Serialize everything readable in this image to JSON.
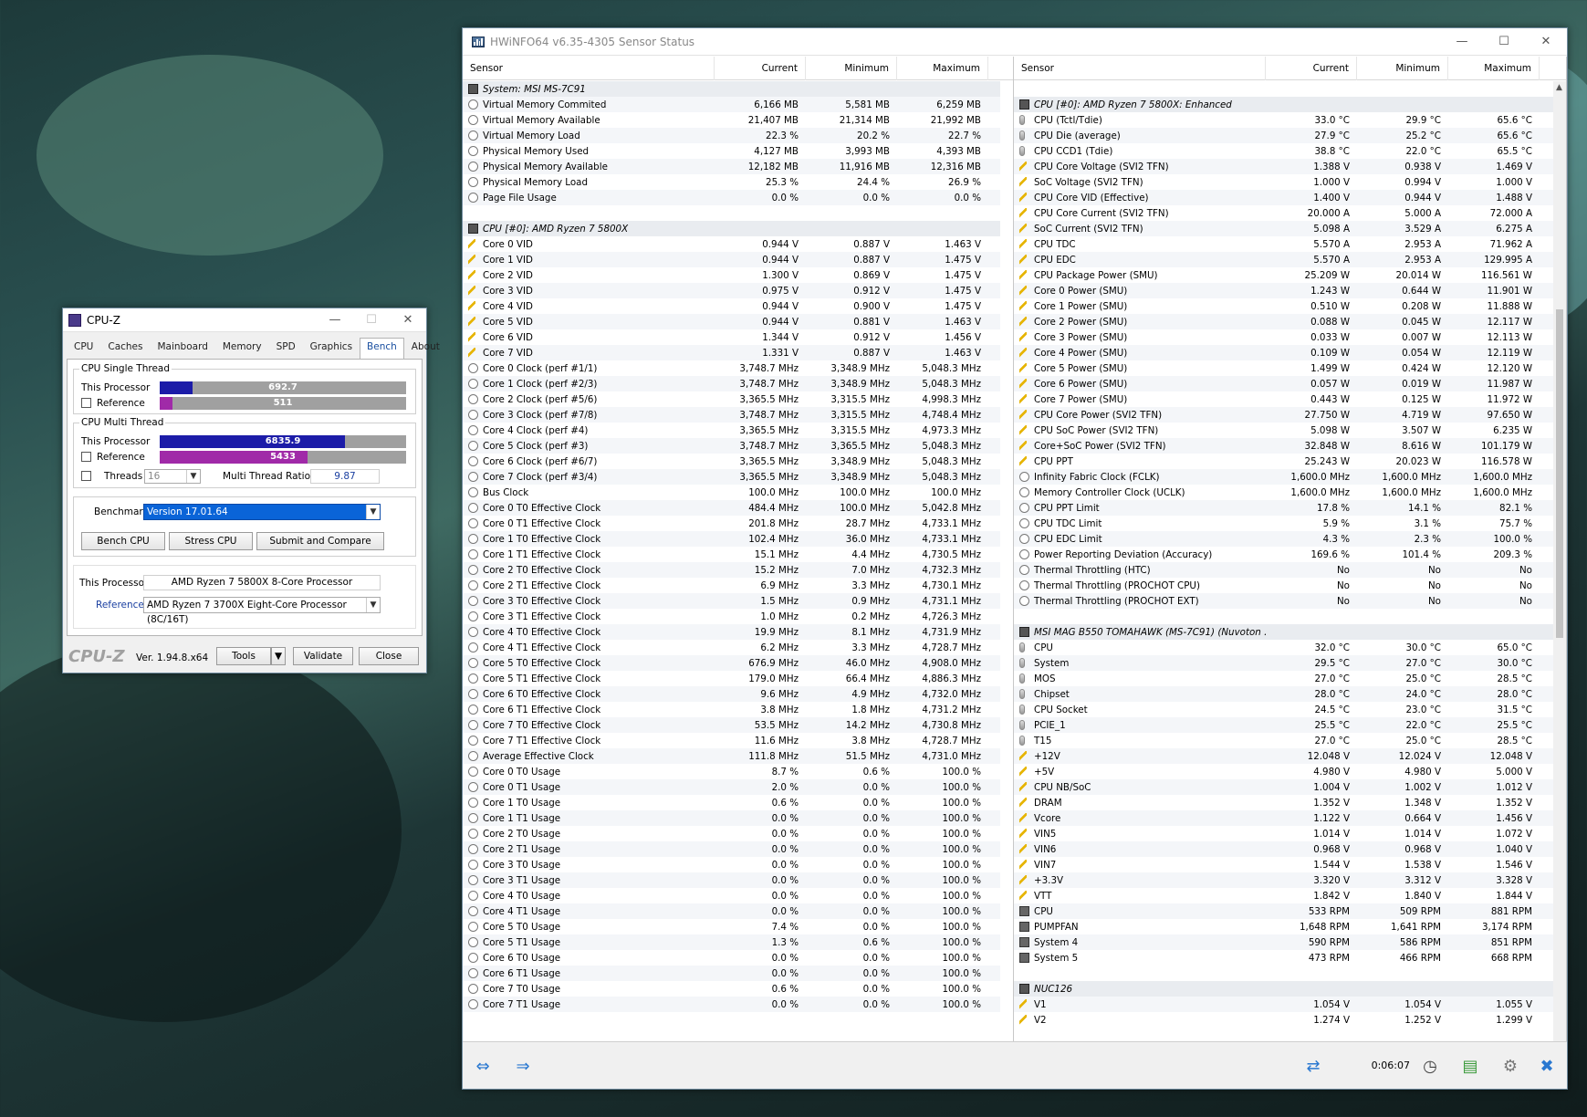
{
  "hwinfo": {
    "title": "HWiNFO64 v6.35-4305 Sensor Status",
    "header": {
      "sensor": "Sensor",
      "current": "Current",
      "minimum": "Minimum",
      "maximum": "Maximum"
    },
    "timer": "0:06:07",
    "left_rows": [
      {
        "t": "grp",
        "n": "System: MSI MS-7C91"
      },
      {
        "t": "clock",
        "n": "Virtual Memory Commited",
        "c": "6,166 MB",
        "mi": "5,581 MB",
        "ma": "6,259 MB"
      },
      {
        "t": "clock",
        "n": "Virtual Memory Available",
        "c": "21,407 MB",
        "mi": "21,314 MB",
        "ma": "21,992 MB"
      },
      {
        "t": "clock",
        "n": "Virtual Memory Load",
        "c": "22.3 %",
        "mi": "20.2 %",
        "ma": "22.7 %"
      },
      {
        "t": "clock",
        "n": "Physical Memory Used",
        "c": "4,127 MB",
        "mi": "3,993 MB",
        "ma": "4,393 MB"
      },
      {
        "t": "clock",
        "n": "Physical Memory Available",
        "c": "12,182 MB",
        "mi": "11,916 MB",
        "ma": "12,316 MB"
      },
      {
        "t": "clock",
        "n": "Physical Memory Load",
        "c": "25.3 %",
        "mi": "24.4 %",
        "ma": "26.9 %"
      },
      {
        "t": "clock",
        "n": "Page File Usage",
        "c": "0.0 %",
        "mi": "0.0 %",
        "ma": "0.0 %"
      },
      {
        "t": "blank"
      },
      {
        "t": "grp",
        "n": "CPU [#0]: AMD Ryzen 7 5800X"
      },
      {
        "t": "volt",
        "n": "Core 0 VID",
        "c": "0.944 V",
        "mi": "0.887 V",
        "ma": "1.463 V"
      },
      {
        "t": "volt",
        "n": "Core 1 VID",
        "c": "0.944 V",
        "mi": "0.887 V",
        "ma": "1.475 V"
      },
      {
        "t": "volt",
        "n": "Core 2 VID",
        "c": "1.300 V",
        "mi": "0.869 V",
        "ma": "1.475 V"
      },
      {
        "t": "volt",
        "n": "Core 3 VID",
        "c": "0.975 V",
        "mi": "0.912 V",
        "ma": "1.475 V"
      },
      {
        "t": "volt",
        "n": "Core 4 VID",
        "c": "0.944 V",
        "mi": "0.900 V",
        "ma": "1.475 V"
      },
      {
        "t": "volt",
        "n": "Core 5 VID",
        "c": "0.944 V",
        "mi": "0.881 V",
        "ma": "1.463 V"
      },
      {
        "t": "volt",
        "n": "Core 6 VID",
        "c": "1.344 V",
        "mi": "0.912 V",
        "ma": "1.456 V"
      },
      {
        "t": "volt",
        "n": "Core 7 VID",
        "c": "1.331 V",
        "mi": "0.887 V",
        "ma": "1.463 V"
      },
      {
        "t": "clock",
        "n": "Core 0 Clock (perf #1/1)",
        "c": "3,748.7 MHz",
        "mi": "3,348.9 MHz",
        "ma": "5,048.3 MHz"
      },
      {
        "t": "clock",
        "n": "Core 1 Clock (perf #2/3)",
        "c": "3,748.7 MHz",
        "mi": "3,348.9 MHz",
        "ma": "5,048.3 MHz"
      },
      {
        "t": "clock",
        "n": "Core 2 Clock (perf #5/6)",
        "c": "3,365.5 MHz",
        "mi": "3,315.5 MHz",
        "ma": "4,998.3 MHz"
      },
      {
        "t": "clock",
        "n": "Core 3 Clock (perf #7/8)",
        "c": "3,748.7 MHz",
        "mi": "3,315.5 MHz",
        "ma": "4,748.4 MHz"
      },
      {
        "t": "clock",
        "n": "Core 4 Clock (perf #4)",
        "c": "3,365.5 MHz",
        "mi": "3,315.5 MHz",
        "ma": "4,973.3 MHz"
      },
      {
        "t": "clock",
        "n": "Core 5 Clock (perf #3)",
        "c": "3,748.7 MHz",
        "mi": "3,365.5 MHz",
        "ma": "5,048.3 MHz"
      },
      {
        "t": "clock",
        "n": "Core 6 Clock (perf #6/7)",
        "c": "3,365.5 MHz",
        "mi": "3,348.9 MHz",
        "ma": "5,048.3 MHz"
      },
      {
        "t": "clock",
        "n": "Core 7 Clock (perf #3/4)",
        "c": "3,365.5 MHz",
        "mi": "3,348.9 MHz",
        "ma": "5,048.3 MHz"
      },
      {
        "t": "clock",
        "n": "Bus Clock",
        "c": "100.0 MHz",
        "mi": "100.0 MHz",
        "ma": "100.0 MHz"
      },
      {
        "t": "clock",
        "n": "Core 0 T0 Effective Clock",
        "c": "484.4 MHz",
        "mi": "100.0 MHz",
        "ma": "5,042.8 MHz"
      },
      {
        "t": "clock",
        "n": "Core 0 T1 Effective Clock",
        "c": "201.8 MHz",
        "mi": "28.7 MHz",
        "ma": "4,733.1 MHz"
      },
      {
        "t": "clock",
        "n": "Core 1 T0 Effective Clock",
        "c": "102.4 MHz",
        "mi": "36.0 MHz",
        "ma": "4,733.1 MHz"
      },
      {
        "t": "clock",
        "n": "Core 1 T1 Effective Clock",
        "c": "15.1 MHz",
        "mi": "4.4 MHz",
        "ma": "4,730.5 MHz"
      },
      {
        "t": "clock",
        "n": "Core 2 T0 Effective Clock",
        "c": "15.2 MHz",
        "mi": "7.0 MHz",
        "ma": "4,732.3 MHz"
      },
      {
        "t": "clock",
        "n": "Core 2 T1 Effective Clock",
        "c": "6.9 MHz",
        "mi": "3.3 MHz",
        "ma": "4,730.1 MHz"
      },
      {
        "t": "clock",
        "n": "Core 3 T0 Effective Clock",
        "c": "1.5 MHz",
        "mi": "0.9 MHz",
        "ma": "4,731.1 MHz"
      },
      {
        "t": "clock",
        "n": "Core 3 T1 Effective Clock",
        "c": "1.0 MHz",
        "mi": "0.2 MHz",
        "ma": "4,726.3 MHz"
      },
      {
        "t": "clock",
        "n": "Core 4 T0 Effective Clock",
        "c": "19.9 MHz",
        "mi": "8.1 MHz",
        "ma": "4,731.9 MHz"
      },
      {
        "t": "clock",
        "n": "Core 4 T1 Effective Clock",
        "c": "6.2 MHz",
        "mi": "3.3 MHz",
        "ma": "4,728.7 MHz"
      },
      {
        "t": "clock",
        "n": "Core 5 T0 Effective Clock",
        "c": "676.9 MHz",
        "mi": "46.0 MHz",
        "ma": "4,908.0 MHz"
      },
      {
        "t": "clock",
        "n": "Core 5 T1 Effective Clock",
        "c": "179.0 MHz",
        "mi": "66.4 MHz",
        "ma": "4,886.3 MHz"
      },
      {
        "t": "clock",
        "n": "Core 6 T0 Effective Clock",
        "c": "9.6 MHz",
        "mi": "4.9 MHz",
        "ma": "4,732.0 MHz"
      },
      {
        "t": "clock",
        "n": "Core 6 T1 Effective Clock",
        "c": "3.8 MHz",
        "mi": "1.8 MHz",
        "ma": "4,731.2 MHz"
      },
      {
        "t": "clock",
        "n": "Core 7 T0 Effective Clock",
        "c": "53.5 MHz",
        "mi": "14.2 MHz",
        "ma": "4,730.8 MHz"
      },
      {
        "t": "clock",
        "n": "Core 7 T1 Effective Clock",
        "c": "11.6 MHz",
        "mi": "3.8 MHz",
        "ma": "4,728.7 MHz"
      },
      {
        "t": "clock",
        "n": "Average Effective Clock",
        "c": "111.8 MHz",
        "mi": "51.5 MHz",
        "ma": "4,731.0 MHz"
      },
      {
        "t": "clock",
        "n": "Core 0 T0 Usage",
        "c": "8.7 %",
        "mi": "0.6 %",
        "ma": "100.0 %"
      },
      {
        "t": "clock",
        "n": "Core 0 T1 Usage",
        "c": "2.0 %",
        "mi": "0.0 %",
        "ma": "100.0 %"
      },
      {
        "t": "clock",
        "n": "Core 1 T0 Usage",
        "c": "0.6 %",
        "mi": "0.0 %",
        "ma": "100.0 %"
      },
      {
        "t": "clock",
        "n": "Core 1 T1 Usage",
        "c": "0.0 %",
        "mi": "0.0 %",
        "ma": "100.0 %"
      },
      {
        "t": "clock",
        "n": "Core 2 T0 Usage",
        "c": "0.0 %",
        "mi": "0.0 %",
        "ma": "100.0 %"
      },
      {
        "t": "clock",
        "n": "Core 2 T1 Usage",
        "c": "0.0 %",
        "mi": "0.0 %",
        "ma": "100.0 %"
      },
      {
        "t": "clock",
        "n": "Core 3 T0 Usage",
        "c": "0.0 %",
        "mi": "0.0 %",
        "ma": "100.0 %"
      },
      {
        "t": "clock",
        "n": "Core 3 T1 Usage",
        "c": "0.0 %",
        "mi": "0.0 %",
        "ma": "100.0 %"
      },
      {
        "t": "clock",
        "n": "Core 4 T0 Usage",
        "c": "0.0 %",
        "mi": "0.0 %",
        "ma": "100.0 %"
      },
      {
        "t": "clock",
        "n": "Core 4 T1 Usage",
        "c": "0.0 %",
        "mi": "0.0 %",
        "ma": "100.0 %"
      },
      {
        "t": "clock",
        "n": "Core 5 T0 Usage",
        "c": "7.4 %",
        "mi": "0.0 %",
        "ma": "100.0 %"
      },
      {
        "t": "clock",
        "n": "Core 5 T1 Usage",
        "c": "1.3 %",
        "mi": "0.6 %",
        "ma": "100.0 %"
      },
      {
        "t": "clock",
        "n": "Core 6 T0 Usage",
        "c": "0.0 %",
        "mi": "0.0 %",
        "ma": "100.0 %"
      },
      {
        "t": "clock",
        "n": "Core 6 T1 Usage",
        "c": "0.0 %",
        "mi": "0.0 %",
        "ma": "100.0 %"
      },
      {
        "t": "clock",
        "n": "Core 7 T0 Usage",
        "c": "0.6 %",
        "mi": "0.0 %",
        "ma": "100.0 %"
      },
      {
        "t": "clock",
        "n": "Core 7 T1 Usage",
        "c": "0.0 %",
        "mi": "0.0 %",
        "ma": "100.0 %"
      }
    ],
    "right_rows": [
      {
        "t": "blank"
      },
      {
        "t": "grp",
        "n": "CPU [#0]: AMD Ryzen 7 5800X: Enhanced"
      },
      {
        "t": "temp",
        "n": "CPU (Tctl/Tdie)",
        "c": "33.0 °C",
        "mi": "29.9 °C",
        "ma": "65.6 °C"
      },
      {
        "t": "temp",
        "n": "CPU Die (average)",
        "c": "27.9 °C",
        "mi": "25.2 °C",
        "ma": "65.6 °C"
      },
      {
        "t": "temp",
        "n": "CPU CCD1 (Tdie)",
        "c": "38.8 °C",
        "mi": "22.0 °C",
        "ma": "65.5 °C"
      },
      {
        "t": "volt",
        "n": "CPU Core Voltage (SVI2 TFN)",
        "c": "1.388 V",
        "mi": "0.938 V",
        "ma": "1.469 V"
      },
      {
        "t": "volt",
        "n": "SoC Voltage (SVI2 TFN)",
        "c": "1.000 V",
        "mi": "0.994 V",
        "ma": "1.000 V"
      },
      {
        "t": "volt",
        "n": "CPU Core VID (Effective)",
        "c": "1.400 V",
        "mi": "0.944 V",
        "ma": "1.488 V"
      },
      {
        "t": "volt",
        "n": "CPU Core Current (SVI2 TFN)",
        "c": "20.000 A",
        "mi": "5.000 A",
        "ma": "72.000 A"
      },
      {
        "t": "volt",
        "n": "SoC Current (SVI2 TFN)",
        "c": "5.098 A",
        "mi": "3.529 A",
        "ma": "6.275 A"
      },
      {
        "t": "volt",
        "n": "CPU TDC",
        "c": "5.570 A",
        "mi": "2.953 A",
        "ma": "71.962 A"
      },
      {
        "t": "volt",
        "n": "CPU EDC",
        "c": "5.570 A",
        "mi": "2.953 A",
        "ma": "129.995 A"
      },
      {
        "t": "volt",
        "n": "CPU Package Power (SMU)",
        "c": "25.209 W",
        "mi": "20.014 W",
        "ma": "116.561 W"
      },
      {
        "t": "volt",
        "n": "Core 0 Power (SMU)",
        "c": "1.243 W",
        "mi": "0.644 W",
        "ma": "11.901 W"
      },
      {
        "t": "volt",
        "n": "Core 1 Power (SMU)",
        "c": "0.510 W",
        "mi": "0.208 W",
        "ma": "11.888 W"
      },
      {
        "t": "volt",
        "n": "Core 2 Power (SMU)",
        "c": "0.088 W",
        "mi": "0.045 W",
        "ma": "12.117 W"
      },
      {
        "t": "volt",
        "n": "Core 3 Power (SMU)",
        "c": "0.033 W",
        "mi": "0.007 W",
        "ma": "12.113 W"
      },
      {
        "t": "volt",
        "n": "Core 4 Power (SMU)",
        "c": "0.109 W",
        "mi": "0.054 W",
        "ma": "12.119 W"
      },
      {
        "t": "volt",
        "n": "Core 5 Power (SMU)",
        "c": "1.499 W",
        "mi": "0.424 W",
        "ma": "12.120 W"
      },
      {
        "t": "volt",
        "n": "Core 6 Power (SMU)",
        "c": "0.057 W",
        "mi": "0.019 W",
        "ma": "11.987 W"
      },
      {
        "t": "volt",
        "n": "Core 7 Power (SMU)",
        "c": "0.443 W",
        "mi": "0.125 W",
        "ma": "11.972 W"
      },
      {
        "t": "volt",
        "n": "CPU Core Power (SVI2 TFN)",
        "c": "27.750 W",
        "mi": "4.719 W",
        "ma": "97.650 W"
      },
      {
        "t": "volt",
        "n": "CPU SoC Power (SVI2 TFN)",
        "c": "5.098 W",
        "mi": "3.507 W",
        "ma": "6.235 W"
      },
      {
        "t": "volt",
        "n": "Core+SoC Power (SVI2 TFN)",
        "c": "32.848 W",
        "mi": "8.616 W",
        "ma": "101.179 W"
      },
      {
        "t": "volt",
        "n": "CPU PPT",
        "c": "25.243 W",
        "mi": "20.023 W",
        "ma": "116.578 W"
      },
      {
        "t": "clock",
        "n": "Infinity Fabric Clock (FCLK)",
        "c": "1,600.0 MHz",
        "mi": "1,600.0 MHz",
        "ma": "1,600.0 MHz"
      },
      {
        "t": "clock",
        "n": "Memory Controller Clock (UCLK)",
        "c": "1,600.0 MHz",
        "mi": "1,600.0 MHz",
        "ma": "1,600.0 MHz"
      },
      {
        "t": "clock",
        "n": "CPU PPT Limit",
        "c": "17.8 %",
        "mi": "14.1 %",
        "ma": "82.1 %"
      },
      {
        "t": "clock",
        "n": "CPU TDC Limit",
        "c": "5.9 %",
        "mi": "3.1 %",
        "ma": "75.7 %"
      },
      {
        "t": "clock",
        "n": "CPU EDC Limit",
        "c": "4.3 %",
        "mi": "2.3 %",
        "ma": "100.0 %"
      },
      {
        "t": "clock",
        "n": "Power Reporting Deviation (Accuracy)",
        "c": "169.6 %",
        "mi": "101.4 %",
        "ma": "209.3 %"
      },
      {
        "t": "clock",
        "n": "Thermal Throttling (HTC)",
        "c": "No",
        "mi": "No",
        "ma": "No"
      },
      {
        "t": "clock",
        "n": "Thermal Throttling (PROCHOT CPU)",
        "c": "No",
        "mi": "No",
        "ma": "No"
      },
      {
        "t": "clock",
        "n": "Thermal Throttling (PROCHOT EXT)",
        "c": "No",
        "mi": "No",
        "ma": "No"
      },
      {
        "t": "blank"
      },
      {
        "t": "grp",
        "n": "MSI MAG B550 TOMAHAWK (MS-7C91) (Nuvoton ..."
      },
      {
        "t": "temp",
        "n": "CPU",
        "c": "32.0 °C",
        "mi": "30.0 °C",
        "ma": "65.0 °C"
      },
      {
        "t": "temp",
        "n": "System",
        "c": "29.5 °C",
        "mi": "27.0 °C",
        "ma": "30.0 °C"
      },
      {
        "t": "temp",
        "n": "MOS",
        "c": "27.0 °C",
        "mi": "25.0 °C",
        "ma": "28.5 °C"
      },
      {
        "t": "temp",
        "n": "Chipset",
        "c": "28.0 °C",
        "mi": "24.0 °C",
        "ma": "28.0 °C"
      },
      {
        "t": "temp",
        "n": "CPU Socket",
        "c": "24.5 °C",
        "mi": "23.0 °C",
        "ma": "31.5 °C"
      },
      {
        "t": "temp",
        "n": "PCIE_1",
        "c": "25.5 °C",
        "mi": "22.0 °C",
        "ma": "25.5 °C"
      },
      {
        "t": "temp",
        "n": "T15",
        "c": "27.0 °C",
        "mi": "25.0 °C",
        "ma": "28.5 °C"
      },
      {
        "t": "volt",
        "n": "+12V",
        "c": "12.048 V",
        "mi": "12.024 V",
        "ma": "12.048 V"
      },
      {
        "t": "volt",
        "n": "+5V",
        "c": "4.980 V",
        "mi": "4.980 V",
        "ma": "5.000 V"
      },
      {
        "t": "volt",
        "n": "CPU NB/SoC",
        "c": "1.004 V",
        "mi": "1.002 V",
        "ma": "1.012 V"
      },
      {
        "t": "volt",
        "n": "DRAM",
        "c": "1.352 V",
        "mi": "1.348 V",
        "ma": "1.352 V"
      },
      {
        "t": "volt",
        "n": "Vcore",
        "c": "1.122 V",
        "mi": "0.664 V",
        "ma": "1.456 V"
      },
      {
        "t": "volt",
        "n": "VIN5",
        "c": "1.014 V",
        "mi": "1.014 V",
        "ma": "1.072 V"
      },
      {
        "t": "volt",
        "n": "VIN6",
        "c": "0.968 V",
        "mi": "0.968 V",
        "ma": "1.040 V"
      },
      {
        "t": "volt",
        "n": "VIN7",
        "c": "1.544 V",
        "mi": "1.538 V",
        "ma": "1.546 V"
      },
      {
        "t": "volt",
        "n": "+3.3V",
        "c": "3.320 V",
        "mi": "3.312 V",
        "ma": "3.328 V"
      },
      {
        "t": "volt",
        "n": "VTT",
        "c": "1.842 V",
        "mi": "1.840 V",
        "ma": "1.844 V"
      },
      {
        "t": "fan",
        "n": "CPU",
        "c": "533 RPM",
        "mi": "509 RPM",
        "ma": "881 RPM"
      },
      {
        "t": "fan",
        "n": "PUMPFAN",
        "c": "1,648 RPM",
        "mi": "1,641 RPM",
        "ma": "3,174 RPM"
      },
      {
        "t": "fan",
        "n": "System 4",
        "c": "590 RPM",
        "mi": "586 RPM",
        "ma": "851 RPM"
      },
      {
        "t": "fan",
        "n": "System 5",
        "c": "473 RPM",
        "mi": "466 RPM",
        "ma": "668 RPM"
      },
      {
        "t": "blank"
      },
      {
        "t": "grp",
        "n": "NUC126"
      },
      {
        "t": "volt",
        "n": "V1",
        "c": "1.054 V",
        "mi": "1.054 V",
        "ma": "1.055 V"
      },
      {
        "t": "volt",
        "n": "V2",
        "c": "1.274 V",
        "mi": "1.252 V",
        "ma": "1.299 V"
      }
    ]
  },
  "cpuz": {
    "title": "CPU-Z",
    "tabs": [
      "CPU",
      "Caches",
      "Mainboard",
      "Memory",
      "SPD",
      "Graphics",
      "Bench",
      "About"
    ],
    "single_thread": {
      "label": "CPU Single Thread",
      "this_label": "This Processor",
      "this_value": "692.7",
      "this_fraction": 0.134,
      "ref_label": "Reference",
      "ref_value": "511",
      "ref_fraction": 0.05
    },
    "multi_thread": {
      "label": "CPU Multi Thread",
      "this_label": "This Processor",
      "this_value": "6835.9",
      "this_fraction": 0.75,
      "ref_label": "Reference",
      "ref_value": "5433",
      "ref_fraction": 0.6,
      "threads_label": "Threads",
      "threads_value": "16",
      "ratio_label": "Multi Thread Ratio",
      "ratio_value": "9.87"
    },
    "benchmark_label": "Benchmark",
    "benchmark_value": "Version 17.01.64",
    "bench_cpu": "Bench CPU",
    "stress_cpu": "Stress CPU",
    "submit": "Submit and Compare",
    "this_processor_label": "This Processor",
    "this_processor_value": "AMD Ryzen 7 5800X 8-Core Processor",
    "reference_label": "Reference",
    "reference_value": "AMD Ryzen 7 3700X Eight-Core Processor (8C/16T)",
    "logo": "CPU-Z",
    "version": "Ver. 1.94.8.x64",
    "tools": "Tools",
    "validate": "Validate",
    "close": "Close",
    "colors": {
      "this_bar": "#1c1ca8",
      "ref_bar": "#a02aa8"
    }
  }
}
